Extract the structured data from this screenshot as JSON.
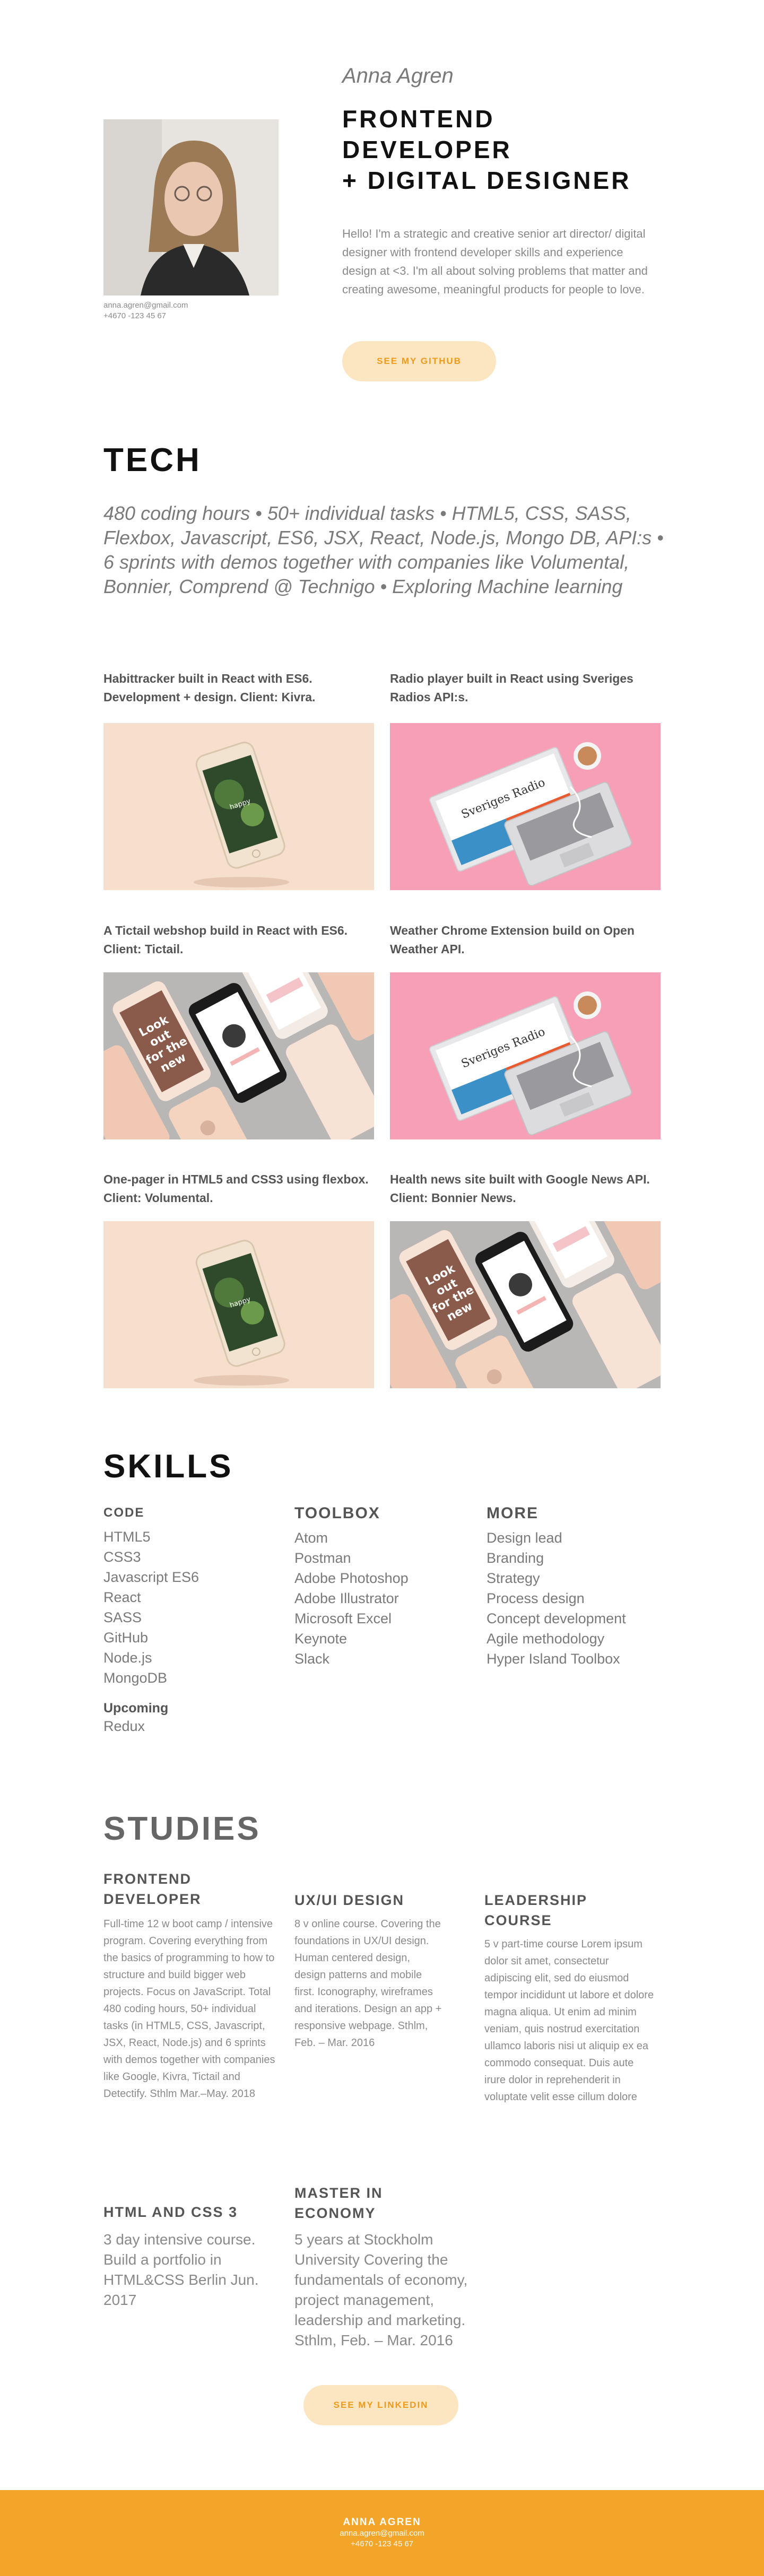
{
  "hero": {
    "name": "Anna Agren",
    "title_lines": [
      "FRONTEND",
      "DEVELOPER",
      "+ DIGITAL DESIGNER"
    ],
    "intro": "Hello! I'm a strategic and creative senior art director/ digital designer with frontend developer skills and experience design at <3. I'm all about solving problems that matter and creating awesome, meaningful products for people to love.",
    "email": "anna.agren@gmail.com",
    "phone": "+4670 -123 45 67",
    "github_label": "SEE MY GITHUB"
  },
  "tech": {
    "title": "TECH",
    "summary": "480 coding hours • 50+ individual tasks • HTML5, CSS, SASS, Flexbox, Javascript, ES6, JSX, React, Node.js, Mongo DB, API:s • 6 sprints with demos together with companies like Volumental, Bonnier, Comprend @ Technigo • Exploring Machine learning",
    "projects": [
      {
        "caption": "Habittracker built in React with ES6. Development + design. Client: Kivra.",
        "image": "phone-mockup"
      },
      {
        "caption": "Radio player built in React using Sveriges Radios API:s.",
        "image": "laptop-mockup"
      },
      {
        "caption": "A Tictail webshop build in React with ES6. Client: Tictail.",
        "image": "phones-grid-mockup"
      },
      {
        "caption": "Weather Chrome Extension build on Open Weather API.",
        "image": "laptop-mockup"
      },
      {
        "caption": "One-pager in HTML5 and CSS3 using flexbox. Client: Volumental.",
        "image": "phone-mockup"
      },
      {
        "caption": "Health news site built with Google News API. Client: Bonnier News.",
        "image": "phones-grid-mockup"
      }
    ],
    "mockup": {
      "laptop_text": "Sveriges Radio",
      "phone_text": [
        "Look",
        "out",
        "for the",
        "new"
      ],
      "phone_small": "Stay safe and sound"
    }
  },
  "skills": {
    "title": "SKILLS",
    "code_head": "CODE",
    "code": [
      "HTML5",
      "CSS3",
      "Javascript ES6",
      "React",
      "SASS",
      "GitHub",
      "Node.js",
      "MongoDB"
    ],
    "upcoming_head": "Upcoming",
    "upcoming": [
      "Redux"
    ],
    "toolbox_head": "TOOLBOX",
    "toolbox": [
      "Atom",
      "Postman",
      "Adobe Photoshop",
      "Adobe Illustrator",
      "Microsoft Excel",
      "Keynote",
      "Slack"
    ],
    "more_head": "MORE",
    "more": [
      "Design lead",
      "Branding",
      "Strategy",
      "Process design",
      "Concept development",
      "Agile methodology",
      "Hyper Island Toolbox"
    ]
  },
  "studies": {
    "title": "STUDIES",
    "items": [
      {
        "head": "FRONTEND DEVELOPER",
        "text": "Full-time 12 w boot camp / intensive program. Covering everything from the basics of programming to how to structure and build bigger web projects. Focus on JavaScript. Total 480 coding hours, 50+ individual tasks (in HTML5, CSS, Javascript, JSX, React, Node.js) and 6 sprints with demos together with companies like Google, Kivra, Tictail and Detectify. Sthlm Mar.–May. 2018"
      },
      {
        "head": "UX/UI DESIGN",
        "text": "8 v online course. Covering the foundations in UX/UI design. Human centered design, design patterns and mobile first. Iconography, wireframes and iterations. Design an app + responsive webpage. Sthlm, Feb. – Mar. 2016"
      },
      {
        "head": "LEADERSHIP COURSE",
        "text": "5 v part-time course Lorem ipsum dolor sit amet, consectetur adipiscing elit, sed do eiusmod tempor incididunt ut labore et dolore magna aliqua. Ut enim ad minim veniam, quis nostrud exercitation ullamco laboris nisi ut aliquip ex ea commodo consequat. Duis aute irure dolor in reprehenderit in voluptate velit esse cillum dolore"
      },
      {
        "head": "HTML AND CSS 3",
        "text": "3 day intensive course. Build a portfolio in HTML&CSS Berlin Jun. 2017"
      },
      {
        "head": "MASTER IN ECONOMY",
        "text": "5 years at Stockholm University Covering the fundamentals of economy, project management, leadership and marketing. Sthlm, Feb. – Mar. 2016"
      }
    ],
    "linkedin_label": "SEE MY LINKEDIN"
  },
  "footer": {
    "name": "ANNA AGREN",
    "email": "anna.agren@gmail.com",
    "phone": "+4670 -123 45 67"
  },
  "colors": {
    "accent": "#f3a52a",
    "pill_bg": "#fbe6c1",
    "pill_text": "#ef9a1a",
    "pink": "#f79fb7",
    "peach": "#f6dfcd"
  }
}
